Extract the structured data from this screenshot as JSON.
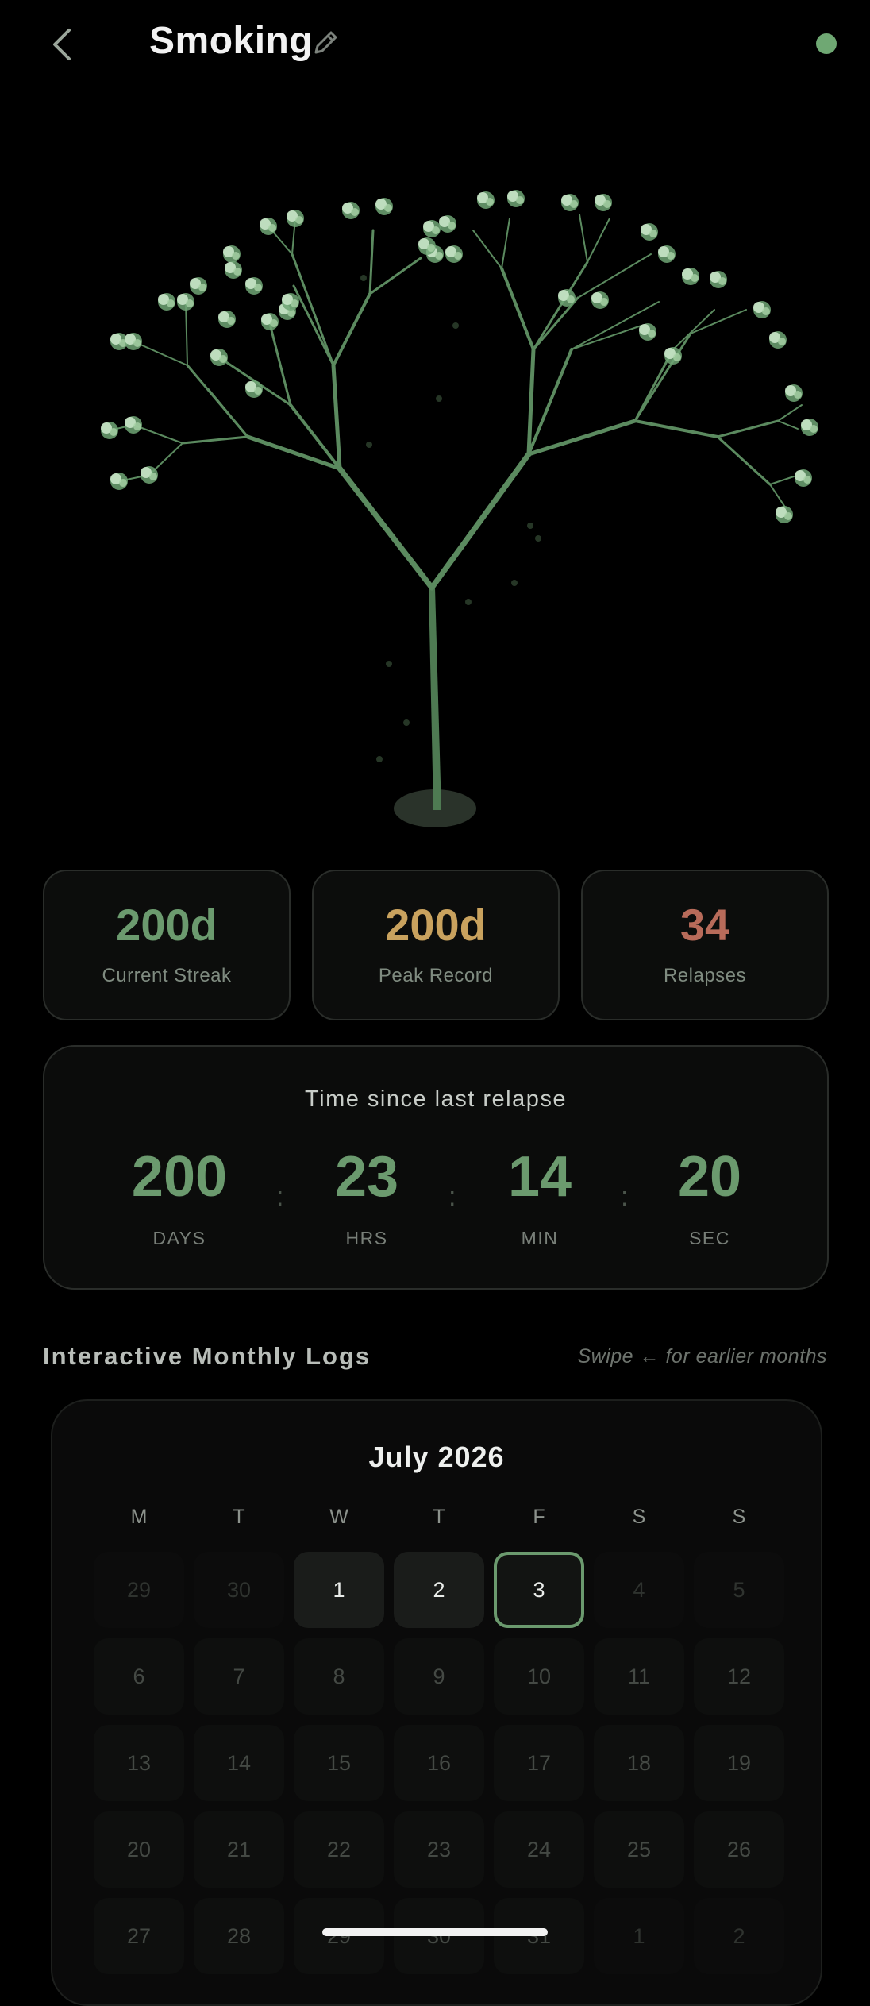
{
  "header": {
    "title": "Smoking"
  },
  "colors": {
    "accent_green": "#6b9a6e",
    "peak_gold": "#c9a25e",
    "relapse_red": "#b86b5a",
    "status_dot": "#6fa873"
  },
  "stats": [
    {
      "value": "200d",
      "label": "Current Streak",
      "color": "#6b9a6e"
    },
    {
      "value": "200d",
      "label": "Peak Record",
      "color": "#c9a25e"
    },
    {
      "value": "34",
      "label": "Relapses",
      "color": "#b86b5a"
    }
  ],
  "timer": {
    "title": "Time since last relapse",
    "units": [
      {
        "value": "200",
        "label": "DAYS"
      },
      {
        "value": "23",
        "label": "HRS"
      },
      {
        "value": "14",
        "label": "MIN"
      },
      {
        "value": "20",
        "label": "SEC"
      }
    ]
  },
  "logs": {
    "title": "Interactive Monthly Logs",
    "hint": "Swipe ← for earlier months"
  },
  "calendar": {
    "month": "July 2026",
    "weekdays": [
      "M",
      "T",
      "W",
      "T",
      "F",
      "S",
      "S"
    ],
    "rows": [
      [
        {
          "d": "29",
          "s": "out"
        },
        {
          "d": "30",
          "s": "out"
        },
        {
          "d": "1",
          "s": "logged"
        },
        {
          "d": "2",
          "s": "logged"
        },
        {
          "d": "3",
          "s": "today"
        },
        {
          "d": "4",
          "s": "out"
        },
        {
          "d": "5",
          "s": "out"
        }
      ],
      [
        {
          "d": "6",
          "s": "past"
        },
        {
          "d": "7",
          "s": "past"
        },
        {
          "d": "8",
          "s": "past"
        },
        {
          "d": "9",
          "s": "past"
        },
        {
          "d": "10",
          "s": "past"
        },
        {
          "d": "11",
          "s": "past"
        },
        {
          "d": "12",
          "s": "past"
        }
      ],
      [
        {
          "d": "13",
          "s": "past"
        },
        {
          "d": "14",
          "s": "past"
        },
        {
          "d": "15",
          "s": "past"
        },
        {
          "d": "16",
          "s": "past"
        },
        {
          "d": "17",
          "s": "past"
        },
        {
          "d": "18",
          "s": "past"
        },
        {
          "d": "19",
          "s": "past"
        }
      ],
      [
        {
          "d": "20",
          "s": "past"
        },
        {
          "d": "21",
          "s": "past"
        },
        {
          "d": "22",
          "s": "past"
        },
        {
          "d": "23",
          "s": "past"
        },
        {
          "d": "24",
          "s": "past"
        },
        {
          "d": "25",
          "s": "past"
        },
        {
          "d": "26",
          "s": "past"
        }
      ],
      [
        {
          "d": "27",
          "s": "past"
        },
        {
          "d": "28",
          "s": "past"
        },
        {
          "d": "29",
          "s": "past"
        },
        {
          "d": "30",
          "s": "past"
        },
        {
          "d": "31",
          "s": "past"
        },
        {
          "d": "1",
          "s": "out"
        },
        {
          "d": "2",
          "s": "out"
        }
      ]
    ]
  }
}
